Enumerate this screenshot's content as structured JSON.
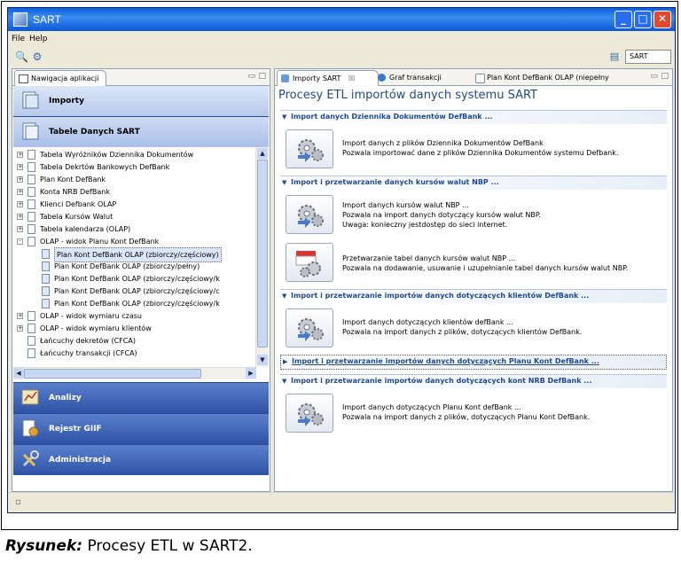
{
  "window": {
    "title": "SART"
  },
  "menu": {
    "file": "File",
    "help": "Help"
  },
  "toolbar": {
    "perspective_label": "SART"
  },
  "left_panel": {
    "tab_label": "Nawigacja aplikacji",
    "nav": {
      "importy": "Importy",
      "tabele": "Tabele Danych SART",
      "analizy": "Analizy",
      "rejestr": "Rejestr GIIF",
      "administracja": "Administracja"
    },
    "tree": [
      {
        "label": "Tabela Wyróżników Dziennika Dokumentów",
        "level": 0,
        "expander": "+"
      },
      {
        "label": "Tabela Dekrtów Bankowych DefBank",
        "level": 0,
        "expander": "+"
      },
      {
        "label": "Plan Kont DefBank",
        "level": 0,
        "expander": "+"
      },
      {
        "label": "Konta NRB DefBank",
        "level": 0,
        "expander": "+"
      },
      {
        "label": "Klienci Defbank OLAP",
        "level": 0,
        "expander": "+"
      },
      {
        "label": "Tabela Kursów Walut",
        "level": 0,
        "expander": "+"
      },
      {
        "label": "Tabela kalendarza (OLAP)",
        "level": 0,
        "expander": "+"
      },
      {
        "label": "OLAP - widok Planu Kont DefBank",
        "level": 0,
        "expander": "-"
      },
      {
        "label": "Plan Kont DefBank OLAP (zbiorczy/częściowy)",
        "level": 1,
        "expander": "",
        "selected": true
      },
      {
        "label": "Plan Kont DefBank OLAP (zbiorczy/pełny)",
        "level": 1,
        "expander": ""
      },
      {
        "label": "Plan Kont DefBank OLAP (zbiorczy/częściowy/k",
        "level": 1,
        "expander": ""
      },
      {
        "label": "Plan Kont DefBank OLAP (zbiorczy/częściowy/c",
        "level": 1,
        "expander": ""
      },
      {
        "label": "Plan Kont DefBank OLAP (zbiorczy/częściowy/k",
        "level": 1,
        "expander": ""
      },
      {
        "label": "OLAP - widok wymiaru czasu",
        "level": 0,
        "expander": "+"
      },
      {
        "label": "OLAP - widok wymiaru klientów",
        "level": 0,
        "expander": "+"
      },
      {
        "label": "Łańcuchy dekretów (CFCA)",
        "level": 0,
        "expander": ""
      },
      {
        "label": "Łańcuchy transakcji (CFCA)",
        "level": 0,
        "expander": ""
      }
    ]
  },
  "right_panel": {
    "tabs": [
      {
        "label": "Importy SART",
        "close": "☒"
      },
      {
        "label": "Graf transakcji",
        "close": ""
      },
      {
        "label": "Plan Kont DefBank OLAP (niepełny",
        "close": ""
      }
    ],
    "heading": "Procesy ETL importów danych systemu SART",
    "sections": {
      "s1": "Import danych Dziennika Dokumentów DefBank ...",
      "s2": "Import i przetwarzanie danych kursów walut NBP ...",
      "s3": "Import i przetwarzanie importów danych dotyczących klientów DefBank ...",
      "s4": "Import i przetwarzanie importów danych dotyczących Planu Kont DefBank ...",
      "s5": "Import i przetwarzanie importów danych dotyczących kont NRB DefBank ..."
    },
    "actions": {
      "a1": {
        "l1": "Import danych z plików Dziennika Dokumentów DefBank",
        "l2": "Pozwala importować dane z plików Dziennika Dokumentów systemu Defbank."
      },
      "a2": {
        "l1": "Import danych kursów walut NBP ...",
        "l2": "Pozwala na import danych dotyczący kursów walut NBP.",
        "l3": "Uwaga: konieczny jestdostęp do sieci internet."
      },
      "a3": {
        "l1": "Przetwarzanie tabel danych kursów walut NBP ...",
        "l2": "Pozwala na dodawanie, usuwanie i uzupełnianie tabel danych kursów walut NBP."
      },
      "a4": {
        "l1": "Import danych dotyczących klientów defBank ...",
        "l2": "Pozwala na import danych z plików, dotyczących klientów DefBank."
      },
      "a5": {
        "l1": "Import danych dotyczących Planu Kont defBank ...",
        "l2": "Pozwala na import danych z plików, dotyczących Planu Kont DefBank."
      }
    }
  },
  "caption": {
    "label": "Rysunek:",
    "text": " Procesy ETL w SART2."
  }
}
